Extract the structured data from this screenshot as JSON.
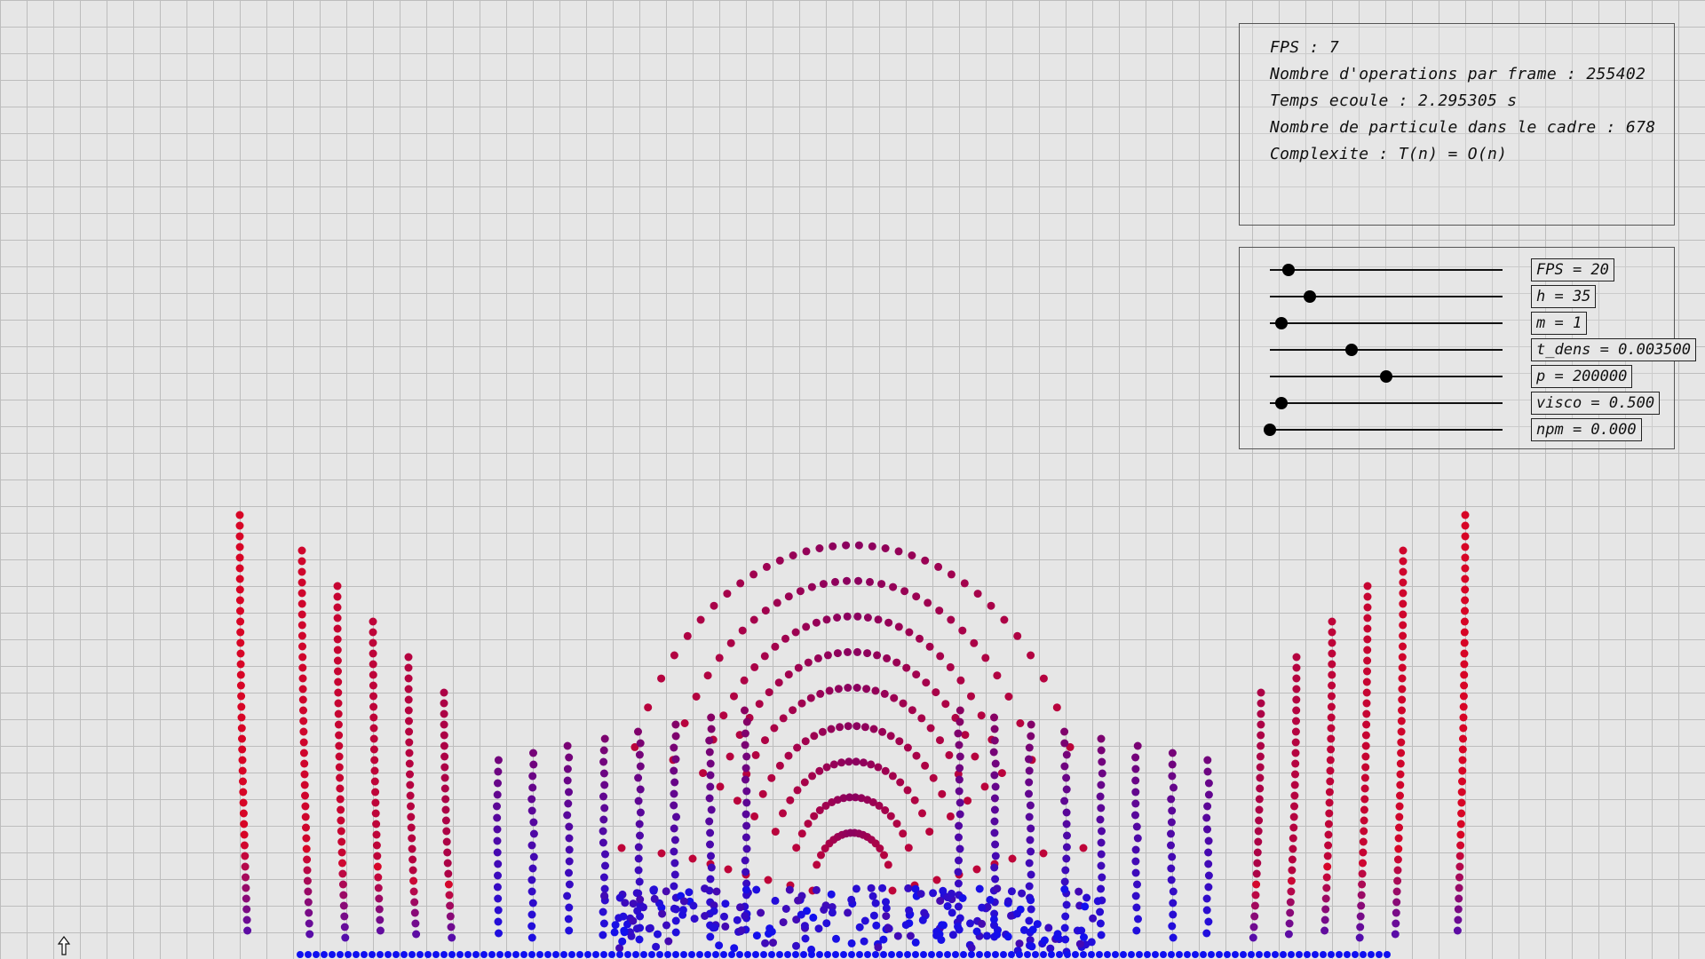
{
  "stats": {
    "fps": "FPS : 7",
    "operations": "Nombre d'operations par frame : 255402",
    "elapsed": "Temps ecoule : 2.295305 s",
    "particles": "Nombre de particule dans le cadre : 678",
    "complexity": "Complexite : T(n) = O(n)"
  },
  "sliders": [
    {
      "label": "FPS = 20",
      "level": 0.08
    },
    {
      "label": "h = 35",
      "level": 0.17
    },
    {
      "label": "m = 1",
      "level": 0.05
    },
    {
      "label": "t_dens = 0.003500",
      "level": 0.35
    },
    {
      "label": "p = 200000",
      "level": 0.5
    },
    {
      "label": "visco = 0.500",
      "level": 0.05
    },
    {
      "label": "npm = 0.000",
      "level": 0.0
    }
  ],
  "colors": {
    "background": "#e6e6e6",
    "grid": "#bdbdbd",
    "particle_hot": "#e0061f",
    "particle_mid": "#8a0060",
    "particle_cold": "#1010f0"
  },
  "icons": {
    "cursor": "cursor-arrow-icon"
  }
}
